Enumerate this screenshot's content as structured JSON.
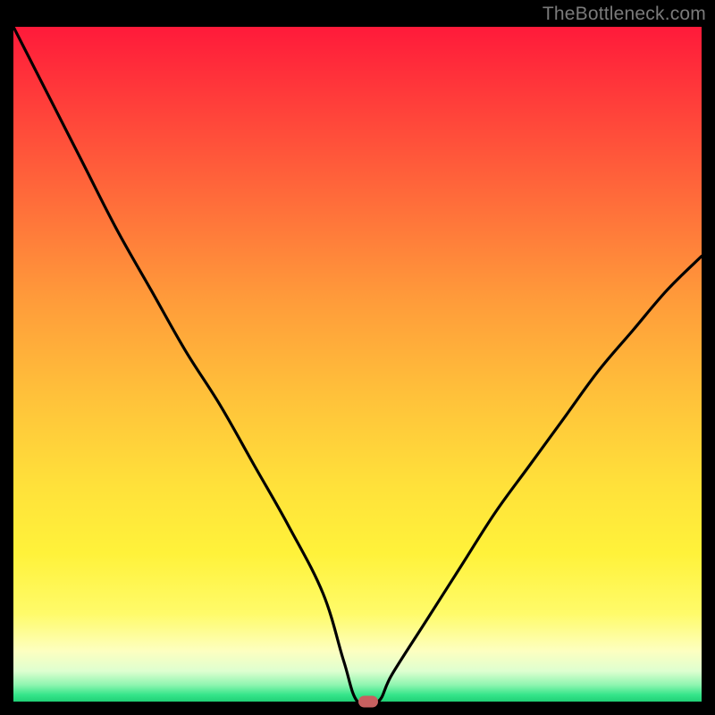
{
  "watermark": {
    "text": "TheBottleneck.com"
  },
  "chart_data": {
    "type": "line",
    "title": "",
    "xlabel": "",
    "ylabel": "",
    "xlim": [
      0,
      100
    ],
    "ylim": [
      0,
      100
    ],
    "series": [
      {
        "name": "bottleneck-curve",
        "x": [
          0,
          5,
          10,
          15,
          20,
          25,
          30,
          35,
          40,
          45,
          48,
          50,
          53,
          55,
          60,
          65,
          70,
          75,
          80,
          85,
          90,
          95,
          100
        ],
        "values": [
          100,
          90,
          80,
          70,
          61,
          52,
          44,
          35,
          26,
          16,
          6,
          0,
          0,
          4,
          12,
          20,
          28,
          35,
          42,
          49,
          55,
          61,
          66
        ]
      }
    ],
    "marker": {
      "x": 51.5,
      "y": 0,
      "name": "optimal-point"
    },
    "background_gradient": {
      "type": "vertical",
      "stops": [
        {
          "pos": 0,
          "color": "#ff1a3a"
        },
        {
          "pos": 50,
          "color": "#ffb13a"
        },
        {
          "pos": 80,
          "color": "#fff23a"
        },
        {
          "pos": 100,
          "color": "#20d076"
        }
      ]
    }
  }
}
